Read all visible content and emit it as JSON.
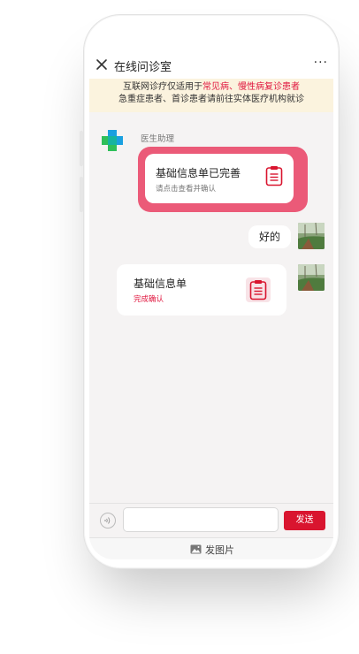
{
  "nav": {
    "title": "在线问诊室",
    "more_label": "···"
  },
  "notice": {
    "line1_prefix": "互联网诊疗仅适用于",
    "line1_highlight": "常见病、慢性病复诊患者",
    "line2": "急重症患者、首诊患者请前往实体医疗机构就诊"
  },
  "doctor": {
    "name": "医生助理"
  },
  "messages": {
    "card1": {
      "title": "基础信息单已完善",
      "subtitle": "请点击查看并确认"
    },
    "reply": {
      "text": "好的"
    },
    "card2": {
      "title": "基础信息单",
      "status": "完成确认"
    }
  },
  "input": {
    "send_label": "发送"
  },
  "photo": {
    "label": "发图片"
  },
  "colors": {
    "accent": "#d9152f",
    "card_border": "#eb5a78",
    "notice_bg": "#fbf3de",
    "doctor_logo_blue": "#1aa0e0",
    "doctor_logo_green": "#2fbf5a"
  },
  "icons": [
    "close-icon",
    "more-icon",
    "doctor-cross-icon",
    "form-clipboard-icon",
    "voice-icon",
    "image-icon"
  ]
}
